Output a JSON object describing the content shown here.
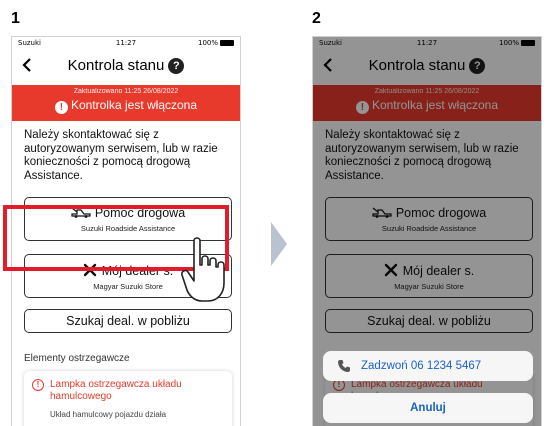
{
  "steps": {
    "first": "1",
    "second": "2"
  },
  "status_bar": {
    "carrier": "Suzuki",
    "time": "11:27",
    "battery": "100%"
  },
  "header": {
    "back_icon": "chevron-left-icon",
    "title": "Kontrola stanu",
    "help_icon": "?"
  },
  "banner": {
    "updated": "Zaktualizowano 11:25 26/08/2022",
    "message": "Kontrolka jest włączona",
    "icon": "!",
    "color": "#e83a2c"
  },
  "info_text": "Należy skontaktować się z autoryzowanym serwisem, lub w razie konieczności z pomocą drogową Assistance.",
  "buttons": {
    "roadside": {
      "label": "Pomoc drogowa",
      "sub": "Suzuki Roadside Assistance",
      "icon": "tow-truck-icon"
    },
    "dealer": {
      "label": "Mój dealer s.",
      "sub": "Magyar Suzuki Store",
      "icon": "tools-icon"
    },
    "search": {
      "label": "Szukaj deal. w pobliżu"
    }
  },
  "warnings": {
    "section_label": "Elementy ostrzegawcze",
    "items": [
      {
        "title": "Lampka ostrzegawcza układu hamulcowego",
        "desc": "Układ hamulcowy pojazdu działa"
      }
    ]
  },
  "action_sheet": {
    "call_label": "Zadzwoń 06 1234 5467",
    "cancel_label": "Anuluj",
    "accent": "#1a63c6"
  },
  "highlight_color": "#e11d2c"
}
